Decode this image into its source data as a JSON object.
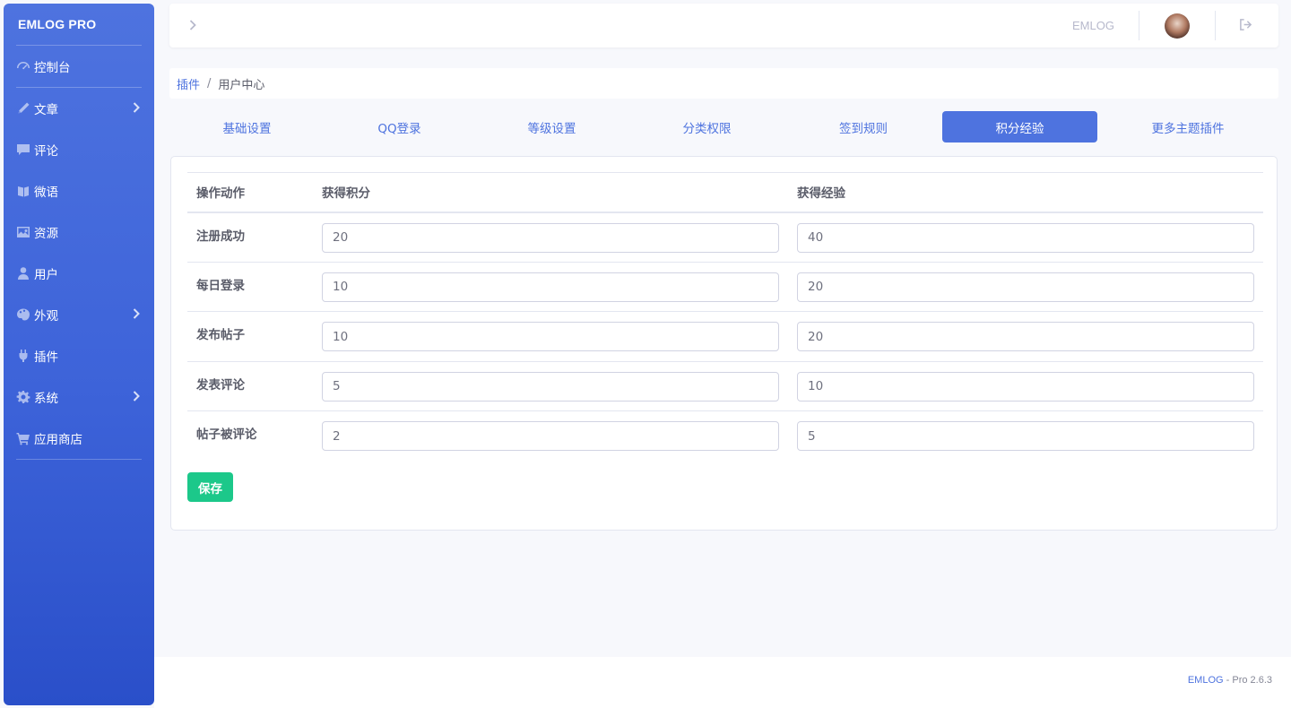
{
  "sidebar": {
    "brand": "EMLOG PRO",
    "items": [
      {
        "label": "控制台",
        "icon": "dashboard-icon",
        "has_submenu": false
      },
      {
        "label": "文章",
        "icon": "pencil-icon",
        "has_submenu": true
      },
      {
        "label": "评论",
        "icon": "comment-icon",
        "has_submenu": false
      },
      {
        "label": "微语",
        "icon": "twitter-cards-icon",
        "has_submenu": false
      },
      {
        "label": "资源",
        "icon": "image-icon",
        "has_submenu": false
      },
      {
        "label": "用户",
        "icon": "user-icon",
        "has_submenu": false
      },
      {
        "label": "外观",
        "icon": "palette-icon",
        "has_submenu": true
      },
      {
        "label": "插件",
        "icon": "plug-icon",
        "has_submenu": false
      },
      {
        "label": "系统",
        "icon": "gear-icon",
        "has_submenu": true
      },
      {
        "label": "应用商店",
        "icon": "cart-icon",
        "has_submenu": false
      }
    ]
  },
  "topbar": {
    "username": "EMLOG"
  },
  "breadcrumb": {
    "parent": "插件",
    "separator": "/",
    "current": "用户中心"
  },
  "tabs": [
    {
      "label": "基础设置",
      "active": false
    },
    {
      "label": "QQ登录",
      "active": false
    },
    {
      "label": "等级设置",
      "active": false
    },
    {
      "label": "分类权限",
      "active": false
    },
    {
      "label": "签到规则",
      "active": false
    },
    {
      "label": "积分经验",
      "active": true
    },
    {
      "label": "更多主题插件",
      "active": false
    }
  ],
  "table": {
    "headers": [
      "操作动作",
      "获得积分",
      "获得经验"
    ],
    "rows": [
      {
        "action": "注册成功",
        "points": "20",
        "exp": "40"
      },
      {
        "action": "每日登录",
        "points": "10",
        "exp": "20"
      },
      {
        "action": "发布帖子",
        "points": "10",
        "exp": "20"
      },
      {
        "action": "发表评论",
        "points": "5",
        "exp": "10"
      },
      {
        "action": "帖子被评论",
        "points": "2",
        "exp": "5"
      }
    ]
  },
  "save_label": "保存",
  "footer": {
    "brand": "EMLOG",
    "version": " - Pro 2.6.3"
  },
  "colors": {
    "primary": "#4e73df",
    "success": "#1cc88a",
    "sidebar_bottom": "#2a4fc9"
  }
}
